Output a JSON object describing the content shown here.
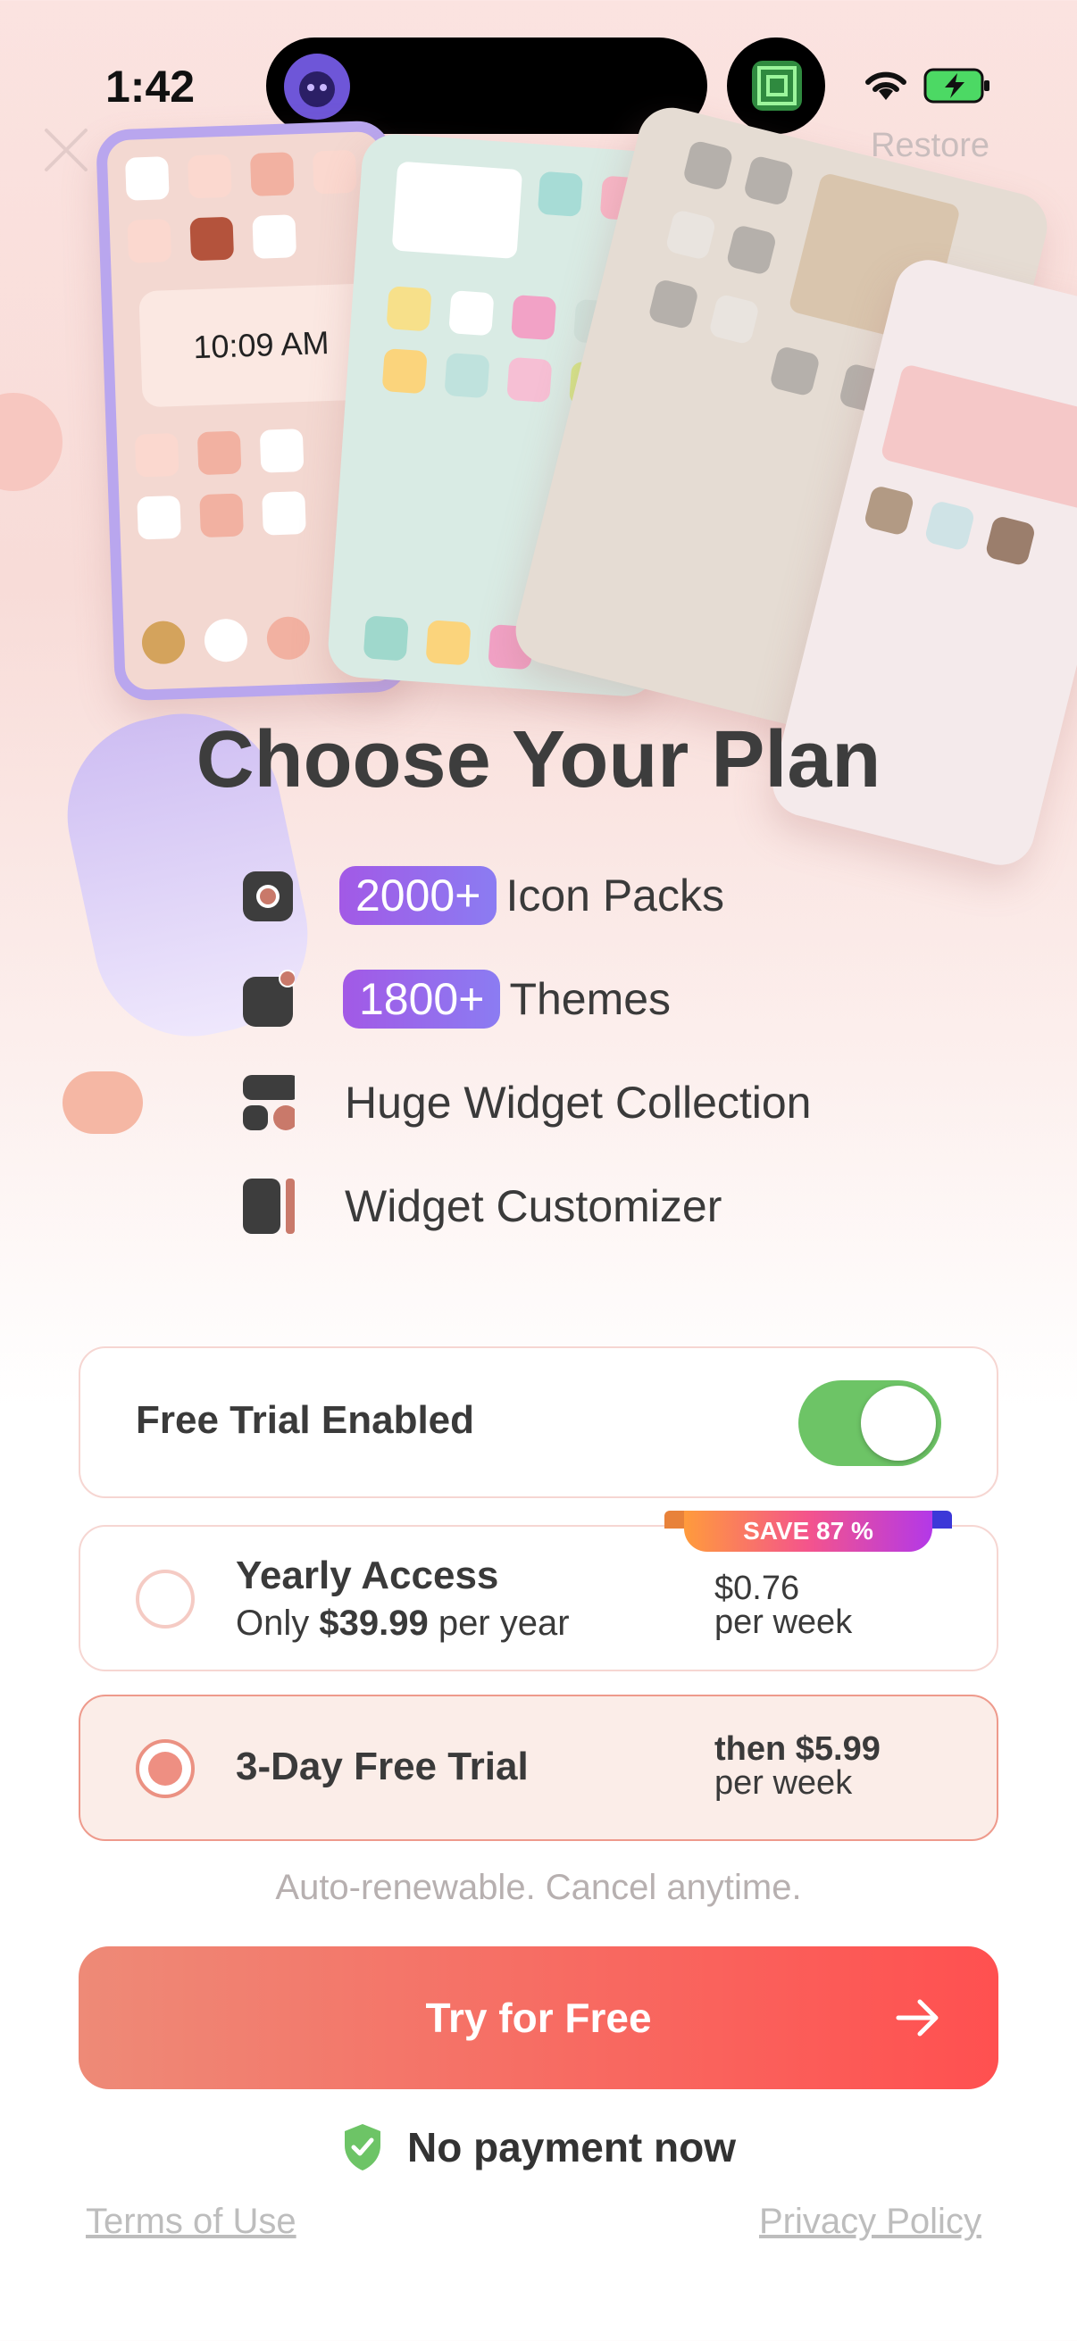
{
  "status_bar": {
    "time": "1:42"
  },
  "header": {
    "restore_label": "Restore"
  },
  "hero": {
    "clock_widget_time": "10:09 AM"
  },
  "title": "Choose Your Plan",
  "features": [
    {
      "icon": "icon-pack-icon",
      "badge": "2000+",
      "label": "Icon Packs"
    },
    {
      "icon": "theme-icon",
      "badge": "1800+",
      "label": "Themes"
    },
    {
      "icon": "widget-icon",
      "badge": "",
      "label": "Huge Widget Collection"
    },
    {
      "icon": "customizer-icon",
      "badge": "",
      "label": "Widget Customizer"
    }
  ],
  "free_trial_toggle": {
    "label": "Free Trial Enabled",
    "enabled": true
  },
  "plans": {
    "yearly": {
      "name": "Yearly Access",
      "sub_prefix": "Only ",
      "sub_price": "$39.99",
      "sub_suffix": " per year",
      "price_line1": "$0.76",
      "price_line2": "per week",
      "badge": "SAVE 87 %",
      "selected": false
    },
    "trial": {
      "name": "3-Day Free Trial",
      "price_line1": "then $5.99",
      "price_line2": "per week",
      "selected": true
    }
  },
  "auto_renew_text": "Auto-renewable. Cancel anytime.",
  "cta": {
    "label": "Try for Free"
  },
  "no_payment_text": "No payment now",
  "footer": {
    "terms": "Terms of Use",
    "privacy": "Privacy Policy"
  },
  "colors": {
    "accent": "#ff5050",
    "toggle_on": "#6dc466",
    "badge_gradient_start": "#a259e6"
  }
}
